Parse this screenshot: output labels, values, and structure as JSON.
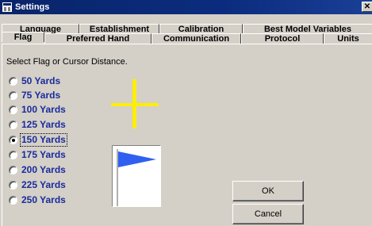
{
  "window": {
    "title": "Settings",
    "close_glyph": "✕"
  },
  "tabs": {
    "back_row": [
      "Language",
      "Establishment",
      "Calibration",
      "Best Model Variables"
    ],
    "front_row": [
      "Flag",
      "Preferred Hand",
      "Communication",
      "Protocol",
      "Units"
    ],
    "active": "Flag"
  },
  "panel": {
    "instruction": "Select Flag or Cursor Distance.",
    "options": [
      "50 Yards",
      "75 Yards",
      "100 Yards",
      "125 Yards",
      "150 Yards",
      "175 Yards",
      "200 Yards",
      "225 Yards",
      "250 Yards"
    ],
    "selected": "150 Yards"
  },
  "buttons": {
    "ok": "OK",
    "cancel": "Cancel"
  },
  "icons": {
    "system": "settings-window-icon",
    "cursor": "crosshair-icon",
    "flag": "flag-icon"
  },
  "colors": {
    "titlebar": "#0a246a",
    "option_text": "#1a2b9c",
    "crosshair": "#ffee00",
    "flag": "#3060f0",
    "face": "#d4d0c8"
  }
}
